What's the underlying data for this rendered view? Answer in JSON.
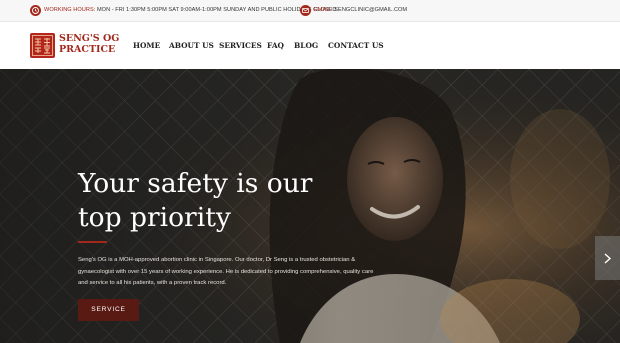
{
  "topbar": {
    "hours_icon": "clock-icon",
    "hours_label": "WORKING HOURS:",
    "hours_value": "MON - FRI 1:30PM 5:00PM   SAT 9:00AM-1:00PM SUNDAY AND PUBLIC HOLIDAYS CLOSED",
    "email_icon": "envelope-icon",
    "email_label": "EMAIL:",
    "email_value": "SENGCLINIC@GMAIL.COM"
  },
  "header": {
    "logo_icon": "clinic-logo-icon",
    "logo_line1": "SENG'S OG",
    "logo_line2": "PRACTICE",
    "nav": [
      "HOME",
      "ABOUT US",
      "SERVICES",
      "FAQ",
      "BLOG",
      "CONTACT US"
    ]
  },
  "hero": {
    "title_line1": "Your safety is our",
    "title_line2": "top priority",
    "description": "Seng's OG is a MOH-approved abortion clinic in Singapore. Our doctor, Dr Seng is a trusted obstetrician & gynaecologist with over 15 years of working experience. He is dedicated to providing comprehensive, quality care and service to all his patients, with a proven track record.",
    "button_label": "SERVICE",
    "next_icon": "chevron-right-icon"
  },
  "colors": {
    "brand": "#a3281b",
    "button": "#5a1a14",
    "topbar_bg": "#f7f7f7"
  }
}
